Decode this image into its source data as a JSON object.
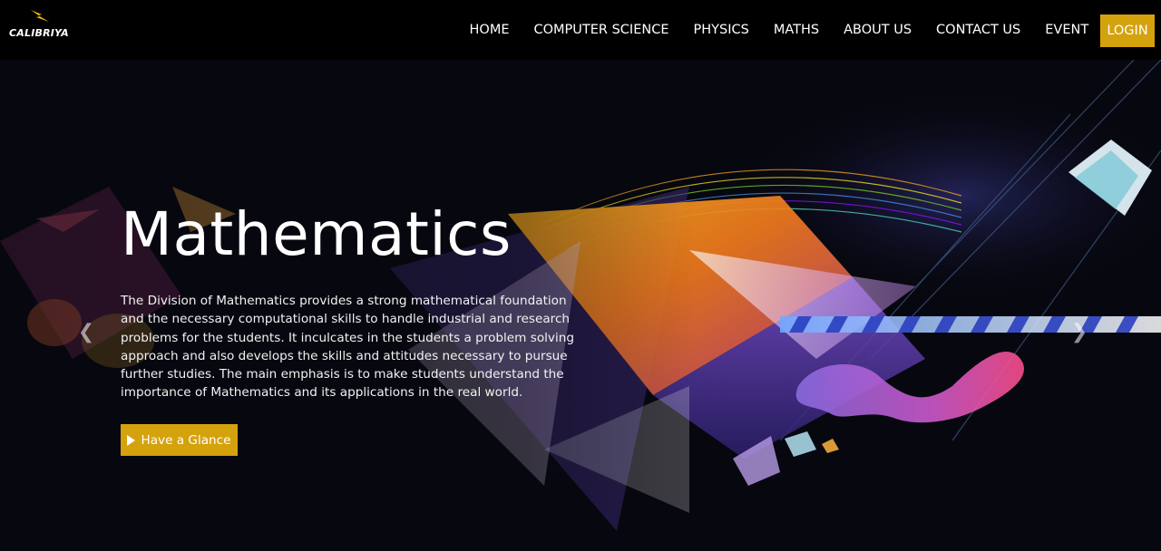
{
  "header": {
    "logo_text": "CALIBRIYA",
    "nav": [
      "HOME",
      "COMPUTER SCIENCE",
      "PHYSICS",
      "MATHS",
      "ABOUT US",
      "CONTACT US",
      "EVENT"
    ],
    "login_label": "LOGIN"
  },
  "hero": {
    "title": "Mathematics",
    "description": "The Division of Mathematics provides a strong mathematical foundation and the necessary computational skills to handle industrial and research problems for the students. It inculcates in the students a problem solving approach and also develops the skills and attitudes necessary to pursue further studies. The main emphasis is to make students understand the importance of Mathematics and its applications in the real world.",
    "button_label": "Have a Glance",
    "prev_icon": "chevron-left-icon",
    "next_icon": "chevron-right-icon"
  },
  "colors": {
    "accent": "#d4a20c",
    "header_bg": "#000000",
    "hero_bg": "#07070f"
  }
}
